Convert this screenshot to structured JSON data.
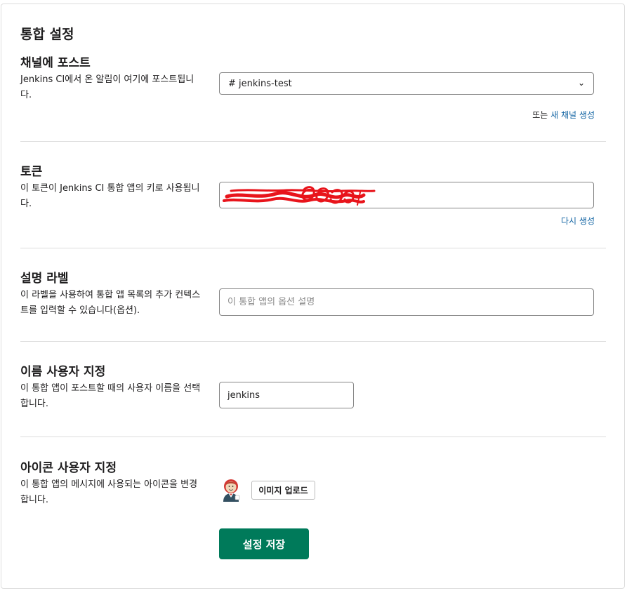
{
  "page_title": "통합 설정",
  "post_channel": {
    "title": "채널에 포스트",
    "description": "Jenkins CI에서 온 알림이 여기에 포스트됩니다.",
    "selected_channel": "# jenkins-test",
    "or_text": "또는",
    "create_channel_link": "새 채널 생성"
  },
  "token": {
    "title": "토큰",
    "description": "이 토큰이 Jenkins CI 통합 앱의 키로 사용됩니다.",
    "regenerate_link": "다시 생성",
    "redaction_color": "#e8141b"
  },
  "description_label": {
    "title": "설명 라벨",
    "description": "이 라벨을 사용하여 통합 앱 목록의 추가 컨텍스트를 입력할 수 있습니다(옵션).",
    "placeholder": "이 통합 앱의 옵션 설명",
    "value": ""
  },
  "custom_name": {
    "title": "이름 사용자 지정",
    "description": "이 통합 앱이 포스트할 때의 사용자 이름을 선택합니다.",
    "value": "jenkins"
  },
  "custom_icon": {
    "title": "아이콘 사용자 지정",
    "description": "이 통합 앱의 메시지에 사용되는 아이콘을 변경합니다.",
    "icon": "jenkins-butler-icon",
    "upload_label": "이미지 업로드"
  },
  "save_button": "설정 저장",
  "colors": {
    "primary": "#007a5a",
    "link": "#1264a3",
    "border": "#868686",
    "divider": "#dddddd"
  }
}
